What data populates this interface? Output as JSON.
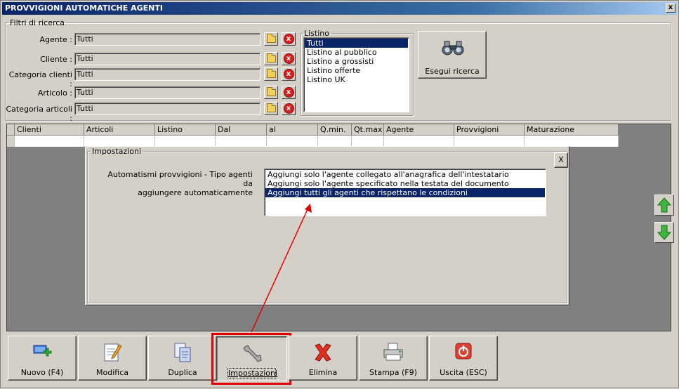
{
  "window": {
    "title": "PROVVIGIONI AUTOMATICHE AGENTI",
    "close_label": "x"
  },
  "filters": {
    "legend": "Filtri di ricerca",
    "rows": [
      {
        "label": "Agente :",
        "value": "Tutti"
      },
      {
        "label": "Cliente :",
        "value": "Tutti"
      },
      {
        "label": "Categoria clienti :",
        "value": "Tutti"
      },
      {
        "label": "Articolo :",
        "value": "Tutti"
      },
      {
        "label": "Categoria articoli :",
        "value": "Tutti"
      }
    ],
    "remove_glyph": "x"
  },
  "listino": {
    "legend": "Listino",
    "items": [
      "Tutti",
      "Listino al pubblico",
      "Listino a grossisti",
      "Listino offerte",
      "Listino UK"
    ],
    "selected_index": 0
  },
  "search": {
    "label": "Esegui ricerca",
    "icon": "binoculars-icon"
  },
  "grid": {
    "columns": [
      "Clienti",
      "Articoli",
      "Listino",
      "Dal",
      "al",
      "Q.min.",
      "Qt.max",
      "Agente",
      "Provvigioni",
      "Maturazione"
    ]
  },
  "settings": {
    "legend": "Impostazioni",
    "close_label": "X",
    "field_label_line1": "Automatismi provvigioni - Tipo agenti da",
    "field_label_line2": "aggiungere automaticamente",
    "options": [
      "Aggiungi solo l'agente collegato all'anagrafica dell'intestatario",
      "Aggiungi solo l'agente specificato nella testata del documento",
      "Aggiungi tutti gli agenti che rispettano le condizioni"
    ],
    "selected_index": 2
  },
  "nav": {
    "up_icon": "arrow-up-icon",
    "down_icon": "arrow-down-icon"
  },
  "toolbar": {
    "buttons": [
      {
        "label": "Nuovo (F4)",
        "icon": "new-record-icon"
      },
      {
        "label": "Modifica",
        "icon": "edit-document-icon"
      },
      {
        "label": "Duplica",
        "icon": "duplicate-icon"
      },
      {
        "label": "Impostazioni",
        "icon": "wrench-icon"
      },
      {
        "label": "Elimina",
        "icon": "delete-x-icon"
      },
      {
        "label": "Stampa (F9)",
        "icon": "printer-icon"
      },
      {
        "label": "Uscita (ESC)",
        "icon": "exit-icon"
      }
    ]
  },
  "colors": {
    "highlight_red": "#e00000",
    "selection": "#0a246a",
    "title_bar": "#0a246a"
  }
}
